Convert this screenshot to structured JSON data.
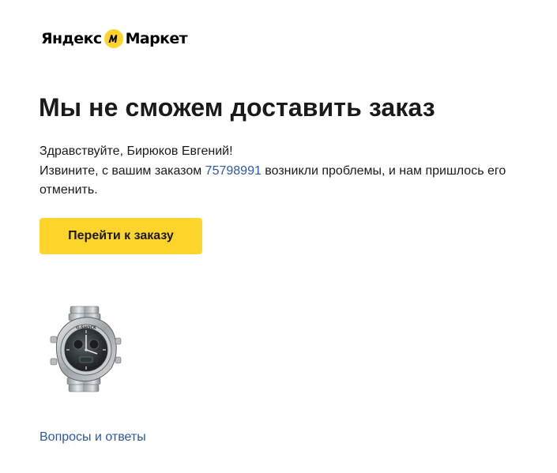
{
  "brand": {
    "left": "Яндекс",
    "right": "Маркет",
    "colors": {
      "mark_bg": "#fed42b",
      "mark_fg": "#000000"
    }
  },
  "title": "Мы не сможем доставить заказ",
  "greeting": "Здравствуйте, Бирюков Евгений!",
  "message": {
    "before": "Извините, с вашим заказом ",
    "order_number": "75798991",
    "after": " возникли проблемы, и нам пришлось его отменить."
  },
  "cta_button": "Перейти к заказу",
  "product": {
    "icon": "watch-image"
  },
  "footer": {
    "faq_link": "Вопросы и ответы"
  },
  "colors": {
    "accent": "#fed42b",
    "link": "#2b57a8",
    "text": "#1a1a1a"
  }
}
